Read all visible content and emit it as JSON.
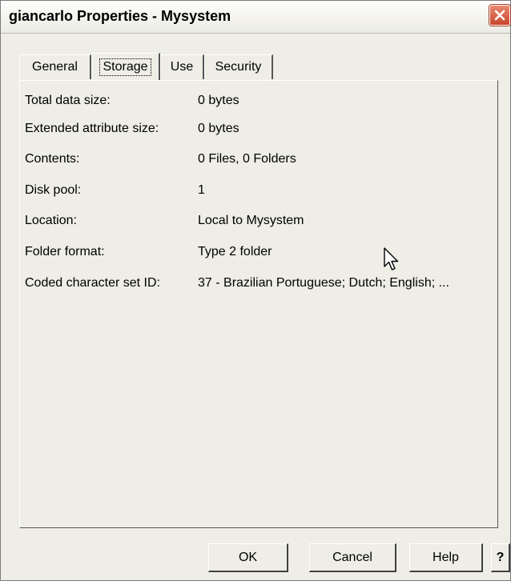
{
  "window": {
    "title": "giancarlo Properties - Mysystem"
  },
  "tabs": [
    {
      "label": "General",
      "active": false
    },
    {
      "label": "Storage",
      "active": true
    },
    {
      "label": "Use",
      "active": false
    },
    {
      "label": "Security",
      "active": false
    }
  ],
  "properties": [
    {
      "label": "Total data size:",
      "value": "0 bytes"
    },
    {
      "label": "Extended attribute size:",
      "value": "0 bytes"
    },
    {
      "label": "Contents:",
      "value": "0 Files, 0 Folders"
    },
    {
      "label": "Disk pool:",
      "value": "1"
    },
    {
      "label": "Location:",
      "value": "Local to Mysystem"
    },
    {
      "label": "Folder format:",
      "value": "Type 2 folder"
    },
    {
      "label": "Coded character set ID:",
      "value": "37 - Brazilian Portuguese; Dutch; English; ..."
    }
  ],
  "buttons": {
    "ok": "OK",
    "cancel": "Cancel",
    "help": "Help",
    "whats_this": "?"
  },
  "icons": {
    "close": "close-icon",
    "cursor": "mouse-pointer-icon"
  },
  "colors": {
    "close_button": "#c9452a",
    "dialog_background": "#eeede6"
  }
}
